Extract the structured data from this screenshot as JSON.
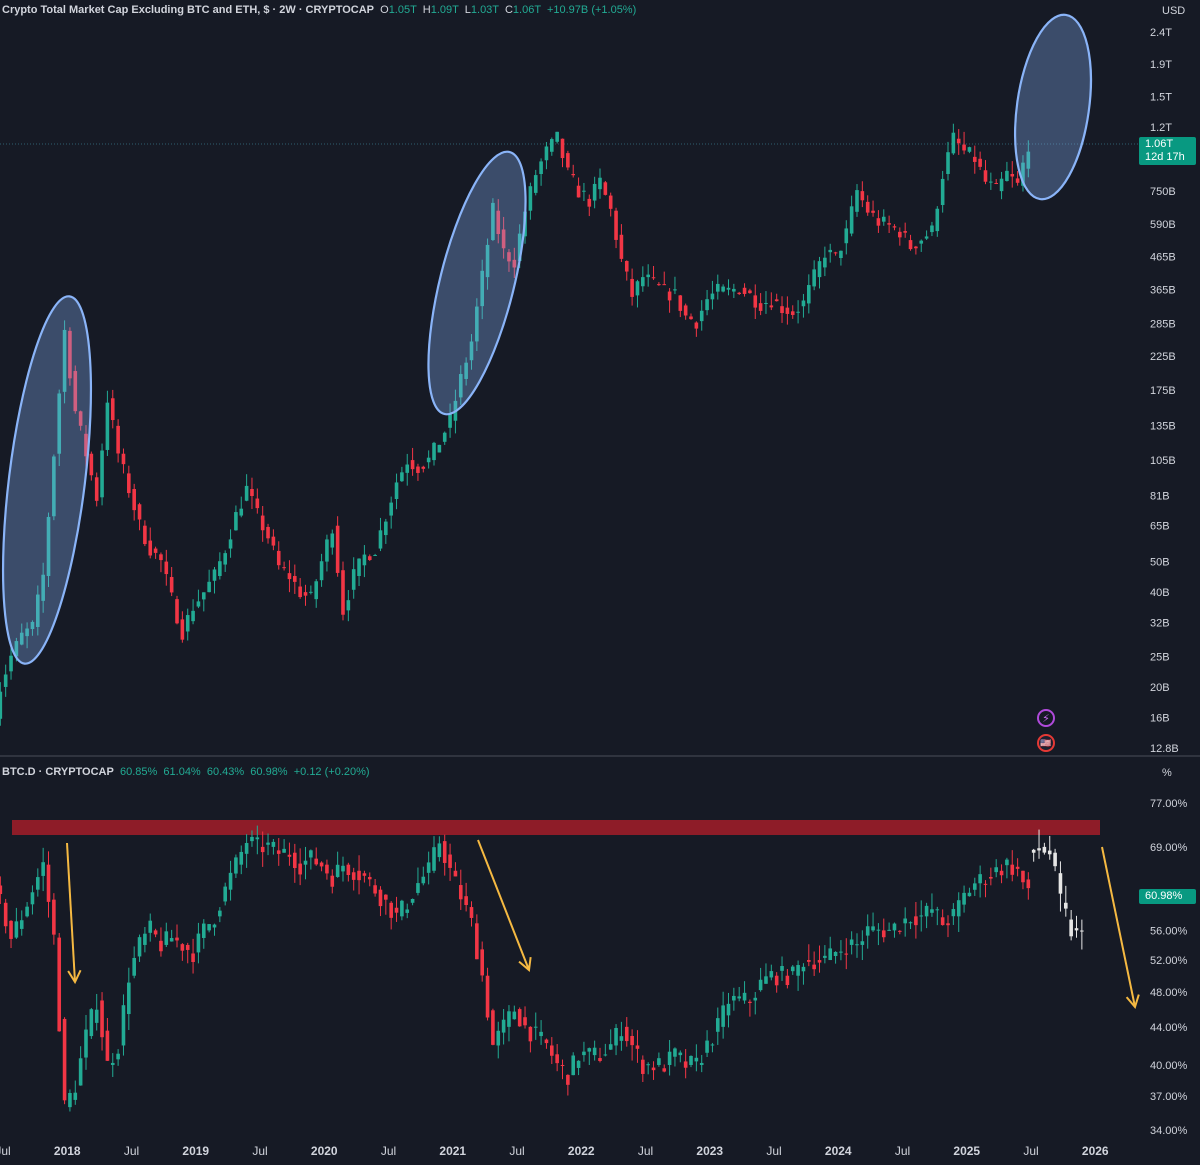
{
  "main_legend": {
    "symbol": "Crypto Total Market Cap Excluding BTC and ETH, $ · 2W · CRYPTOCAP",
    "o_label": "O",
    "o": "1.05T",
    "h_label": "H",
    "h": "1.09T",
    "l_label": "L",
    "l": "1.03T",
    "c_label": "C",
    "c": "1.06T",
    "change": "+10.97B (+1.05%)"
  },
  "main_unit": "USD",
  "main_price_tag": {
    "price": "1.06T",
    "countdown": "12d 17h"
  },
  "dom_legend": {
    "symbol": "BTC.D · CRYPTOCAP",
    "o": "60.85%",
    "h": "61.04%",
    "l": "60.43%",
    "c": "60.98%",
    "change": "+0.12 (+0.20%)"
  },
  "dom_unit": "%",
  "dom_price_tag": "60.98%",
  "icons": {
    "lightning": "lightning-icon",
    "flag": "us-flag-icon"
  },
  "colors": {
    "background": "#161a25",
    "up": "#22ab94",
    "down": "#f23645",
    "ellipse": "#8ab4f8",
    "arrow": "#f5b942",
    "resistance": "#8e1c28",
    "projection": "#e6e6e6",
    "text": "#d1d4dc",
    "grid": "#2a2e39"
  },
  "chart_data": [
    {
      "type": "candlestick",
      "title": "Crypto Total Market Cap Excluding BTC and ETH, $ · 2W · CRYPTOCAP",
      "y_scale": "log",
      "y_unit": "USD",
      "y_ticks": [
        "2.4T",
        "1.9T",
        "1.5T",
        "1.2T",
        "750B",
        "590B",
        "465B",
        "365B",
        "285B",
        "225B",
        "175B",
        "135B",
        "105B",
        "81B",
        "65B",
        "50B",
        "40B",
        "32B",
        "25B",
        "20B",
        "16B",
        "12.8B"
      ],
      "current_price": "1.06T",
      "bar_countdown": "12d 17h",
      "x_tick_labels": [
        "Jul",
        "2018",
        "Jul",
        "2019",
        "Jul",
        "2020",
        "Jul",
        "2021",
        "Jul",
        "2022",
        "Jul",
        "2023",
        "Jul",
        "2024",
        "Jul",
        "2025",
        "Jul",
        "2026"
      ],
      "series_close_USD": [
        {
          "date": "2017-06",
          "close": 13000000000.0
        },
        {
          "date": "2017-07",
          "close": 20000000000.0
        },
        {
          "date": "2017-08",
          "close": 25000000000.0
        },
        {
          "date": "2017-09",
          "close": 29000000000.0
        },
        {
          "date": "2017-10",
          "close": 31000000000.0
        },
        {
          "date": "2017-11",
          "close": 45000000000.0
        },
        {
          "date": "2017-12",
          "close": 110000000000.0
        },
        {
          "date": "2018-01",
          "close": 270000000000.0
        },
        {
          "date": "2018-02",
          "close": 150000000000.0
        },
        {
          "date": "2018-03",
          "close": 110000000000.0
        },
        {
          "date": "2018-04",
          "close": 80000000000.0
        },
        {
          "date": "2018-05",
          "close": 165000000000.0
        },
        {
          "date": "2018-06",
          "close": 110000000000.0
        },
        {
          "date": "2018-07",
          "close": 85000000000.0
        },
        {
          "date": "2018-08",
          "close": 65000000000.0
        },
        {
          "date": "2018-09",
          "close": 55000000000.0
        },
        {
          "date": "2018-10",
          "close": 50000000000.0
        },
        {
          "date": "2018-11",
          "close": 38000000000.0
        },
        {
          "date": "2018-12",
          "close": 30000000000.0
        },
        {
          "date": "2019-01",
          "close": 36000000000.0
        },
        {
          "date": "2019-02",
          "close": 40000000000.0
        },
        {
          "date": "2019-03",
          "close": 45000000000.0
        },
        {
          "date": "2019-04",
          "close": 55000000000.0
        },
        {
          "date": "2019-05",
          "close": 70000000000.0
        },
        {
          "date": "2019-06",
          "close": 85000000000.0
        },
        {
          "date": "2019-07",
          "close": 70000000000.0
        },
        {
          "date": "2019-08",
          "close": 60000000000.0
        },
        {
          "date": "2019-09",
          "close": 48000000000.0
        },
        {
          "date": "2019-10",
          "close": 45000000000.0
        },
        {
          "date": "2019-11",
          "close": 40000000000.0
        },
        {
          "date": "2019-12",
          "close": 38000000000.0
        },
        {
          "date": "2020-01",
          "close": 50000000000.0
        },
        {
          "date": "2020-02",
          "close": 65000000000.0
        },
        {
          "date": "2020-03",
          "close": 35000000000.0
        },
        {
          "date": "2020-04",
          "close": 45000000000.0
        },
        {
          "date": "2020-05",
          "close": 52000000000.0
        },
        {
          "date": "2020-06",
          "close": 55000000000.0
        },
        {
          "date": "2020-07",
          "close": 70000000000.0
        },
        {
          "date": "2020-08",
          "close": 90000000000.0
        },
        {
          "date": "2020-09",
          "close": 105000000000.0
        },
        {
          "date": "2020-10",
          "close": 100000000000.0
        },
        {
          "date": "2020-11",
          "close": 105000000000.0
        },
        {
          "date": "2020-12",
          "close": 120000000000.0
        },
        {
          "date": "2021-01",
          "close": 140000000000.0
        },
        {
          "date": "2021-02",
          "close": 190000000000.0
        },
        {
          "date": "2021-03",
          "close": 250000000000.0
        },
        {
          "date": "2021-04",
          "close": 400000000000.0
        },
        {
          "date": "2021-05",
          "close": 650000000000.0
        },
        {
          "date": "2021-06",
          "close": 480000000000.0
        },
        {
          "date": "2021-07",
          "close": 450000000000.0
        },
        {
          "date": "2021-08",
          "close": 650000000000.0
        },
        {
          "date": "2021-09",
          "close": 850000000000.0
        },
        {
          "date": "2021-10",
          "close": 1000000000000.0
        },
        {
          "date": "2021-11",
          "close": 1100000000000.0
        },
        {
          "date": "2021-12",
          "close": 850000000000.0
        },
        {
          "date": "2022-01",
          "close": 750000000000.0
        },
        {
          "date": "2022-02",
          "close": 700000000000.0
        },
        {
          "date": "2022-03",
          "close": 800000000000.0
        },
        {
          "date": "2022-04",
          "close": 650000000000.0
        },
        {
          "date": "2022-05",
          "close": 450000000000.0
        },
        {
          "date": "2022-06",
          "close": 350000000000.0
        },
        {
          "date": "2022-07",
          "close": 400000000000.0
        },
        {
          "date": "2022-08",
          "close": 380000000000.0
        },
        {
          "date": "2022-09",
          "close": 360000000000.0
        },
        {
          "date": "2022-10",
          "close": 350000000000.0
        },
        {
          "date": "2022-11",
          "close": 300000000000.0
        },
        {
          "date": "2022-12",
          "close": 290000000000.0
        },
        {
          "date": "2023-01",
          "close": 340000000000.0
        },
        {
          "date": "2023-02",
          "close": 360000000000.0
        },
        {
          "date": "2023-03",
          "close": 360000000000.0
        },
        {
          "date": "2023-04",
          "close": 370000000000.0
        },
        {
          "date": "2023-05",
          "close": 350000000000.0
        },
        {
          "date": "2023-06",
          "close": 330000000000.0
        },
        {
          "date": "2023-07",
          "close": 340000000000.0
        },
        {
          "date": "2023-08",
          "close": 320000000000.0
        },
        {
          "date": "2023-09",
          "close": 310000000000.0
        },
        {
          "date": "2023-10",
          "close": 330000000000.0
        },
        {
          "date": "2023-11",
          "close": 400000000000.0
        },
        {
          "date": "2023-12",
          "close": 480000000000.0
        },
        {
          "date": "2024-01",
          "close": 460000000000.0
        },
        {
          "date": "2024-02",
          "close": 550000000000.0
        },
        {
          "date": "2024-03",
          "close": 750000000000.0
        },
        {
          "date": "2024-04",
          "close": 650000000000.0
        },
        {
          "date": "2024-05",
          "close": 600000000000.0
        },
        {
          "date": "2024-06",
          "close": 580000000000.0
        },
        {
          "date": "2024-07",
          "close": 560000000000.0
        },
        {
          "date": "2024-08",
          "close": 500000000000.0
        },
        {
          "date": "2024-09",
          "close": 530000000000.0
        },
        {
          "date": "2024-10",
          "close": 560000000000.0
        },
        {
          "date": "2024-11",
          "close": 850000000000.0
        },
        {
          "date": "2024-12",
          "close": 1100000000000.0
        },
        {
          "date": "2025-01",
          "close": 1000000000000.0
        },
        {
          "date": "2025-02",
          "close": 950000000000.0
        },
        {
          "date": "2025-03",
          "close": 800000000000.0
        },
        {
          "date": "2025-04",
          "close": 750000000000.0
        },
        {
          "date": "2025-05",
          "close": 850000000000.0
        },
        {
          "date": "2025-06",
          "close": 780000000000.0
        },
        {
          "date": "2025-07",
          "close": 1060000000000.0
        }
      ],
      "annotations": [
        {
          "type": "ellipse",
          "label": "",
          "from": "2017-06",
          "to": "2018-01"
        },
        {
          "type": "ellipse",
          "label": "",
          "from": "2020-12",
          "to": "2021-05"
        },
        {
          "type": "ellipse",
          "label": "",
          "from": "2025-05",
          "to": "2025-07"
        }
      ]
    },
    {
      "type": "candlestick",
      "title": "BTC.D · CRYPTOCAP",
      "y_scale": "log",
      "y_unit": "%",
      "y_ticks": [
        "77.00%",
        "69.00%",
        "60.98%",
        "56.00%",
        "52.00%",
        "48.00%",
        "44.00%",
        "40.00%",
        "37.00%",
        "34.00%"
      ],
      "current_value": "60.98%",
      "series_close_pct": [
        {
          "date": "2017-06",
          "close": 64
        },
        {
          "date": "2017-07",
          "close": 60
        },
        {
          "date": "2017-08",
          "close": 55
        },
        {
          "date": "2017-09",
          "close": 58
        },
        {
          "date": "2017-10",
          "close": 62
        },
        {
          "date": "2017-11",
          "close": 66
        },
        {
          "date": "2017-12",
          "close": 55
        },
        {
          "date": "2018-01",
          "close": 36
        },
        {
          "date": "2018-02",
          "close": 38
        },
        {
          "date": "2018-03",
          "close": 43
        },
        {
          "date": "2018-04",
          "close": 47
        },
        {
          "date": "2018-05",
          "close": 40
        },
        {
          "date": "2018-06",
          "close": 42
        },
        {
          "date": "2018-07",
          "close": 50
        },
        {
          "date": "2018-08",
          "close": 54
        },
        {
          "date": "2018-09",
          "close": 56
        },
        {
          "date": "2018-10",
          "close": 54
        },
        {
          "date": "2018-11",
          "close": 55
        },
        {
          "date": "2018-12",
          "close": 54
        },
        {
          "date": "2019-01",
          "close": 53
        },
        {
          "date": "2019-02",
          "close": 56
        },
        {
          "date": "2019-03",
          "close": 58
        },
        {
          "date": "2019-04",
          "close": 62
        },
        {
          "date": "2019-05",
          "close": 66
        },
        {
          "date": "2019-06",
          "close": 70
        },
        {
          "date": "2019-07",
          "close": 69
        },
        {
          "date": "2019-08",
          "close": 69
        },
        {
          "date": "2019-09",
          "close": 68
        },
        {
          "date": "2019-10",
          "close": 68
        },
        {
          "date": "2019-11",
          "close": 66
        },
        {
          "date": "2019-12",
          "close": 67
        },
        {
          "date": "2020-01",
          "close": 66
        },
        {
          "date": "2020-02",
          "close": 64
        },
        {
          "date": "2020-03",
          "close": 66
        },
        {
          "date": "2020-04",
          "close": 65
        },
        {
          "date": "2020-05",
          "close": 64
        },
        {
          "date": "2020-06",
          "close": 62
        },
        {
          "date": "2020-07",
          "close": 60
        },
        {
          "date": "2020-08",
          "close": 58
        },
        {
          "date": "2020-09",
          "close": 60
        },
        {
          "date": "2020-10",
          "close": 63
        },
        {
          "date": "2020-11",
          "close": 65
        },
        {
          "date": "2020-12",
          "close": 70
        },
        {
          "date": "2021-01",
          "close": 65
        },
        {
          "date": "2021-02",
          "close": 61
        },
        {
          "date": "2021-03",
          "close": 57
        },
        {
          "date": "2021-04",
          "close": 50
        },
        {
          "date": "2021-05",
          "close": 42
        },
        {
          "date": "2021-06",
          "close": 44
        },
        {
          "date": "2021-07",
          "close": 46
        },
        {
          "date": "2021-08",
          "close": 44
        },
        {
          "date": "2021-09",
          "close": 43
        },
        {
          "date": "2021-10",
          "close": 42
        },
        {
          "date": "2021-11",
          "close": 40
        },
        {
          "date": "2021-12",
          "close": 39
        },
        {
          "date": "2022-01",
          "close": 41
        },
        {
          "date": "2022-02",
          "close": 41
        },
        {
          "date": "2022-03",
          "close": 41
        },
        {
          "date": "2022-04",
          "close": 42
        },
        {
          "date": "2022-05",
          "close": 44
        },
        {
          "date": "2022-06",
          "close": 42
        },
        {
          "date": "2022-07",
          "close": 40
        },
        {
          "date": "2022-08",
          "close": 40
        },
        {
          "date": "2022-09",
          "close": 40
        },
        {
          "date": "2022-10",
          "close": 41
        },
        {
          "date": "2022-11",
          "close": 40
        },
        {
          "date": "2022-12",
          "close": 40
        },
        {
          "date": "2023-01",
          "close": 42
        },
        {
          "date": "2023-02",
          "close": 44
        },
        {
          "date": "2023-03",
          "close": 47
        },
        {
          "date": "2023-04",
          "close": 47
        },
        {
          "date": "2023-05",
          "close": 47
        },
        {
          "date": "2023-06",
          "close": 49
        },
        {
          "date": "2023-07",
          "close": 50
        },
        {
          "date": "2023-08",
          "close": 50
        },
        {
          "date": "2023-09",
          "close": 50
        },
        {
          "date": "2023-10",
          "close": 52
        },
        {
          "date": "2023-11",
          "close": 52
        },
        {
          "date": "2023-12",
          "close": 52
        },
        {
          "date": "2024-01",
          "close": 53
        },
        {
          "date": "2024-02",
          "close": 54
        },
        {
          "date": "2024-03",
          "close": 54
        },
        {
          "date": "2024-04",
          "close": 56
        },
        {
          "date": "2024-05",
          "close": 56
        },
        {
          "date": "2024-06",
          "close": 56
        },
        {
          "date": "2024-07",
          "close": 57
        },
        {
          "date": "2024-08",
          "close": 58
        },
        {
          "date": "2024-09",
          "close": 58
        },
        {
          "date": "2024-10",
          "close": 59
        },
        {
          "date": "2024-11",
          "close": 57
        },
        {
          "date": "2024-12",
          "close": 58
        },
        {
          "date": "2025-01",
          "close": 61
        },
        {
          "date": "2025-02",
          "close": 63
        },
        {
          "date": "2025-03",
          "close": 64
        },
        {
          "date": "2025-04",
          "close": 65
        },
        {
          "date": "2025-05",
          "close": 66
        },
        {
          "date": "2025-06",
          "close": 65
        },
        {
          "date": "2025-07",
          "close": 60.98
        }
      ],
      "projection_close_pct": [
        {
          "date": "2025-07",
          "close": 68
        },
        {
          "date": "2025-08",
          "close": 69
        },
        {
          "date": "2025-09",
          "close": 68
        },
        {
          "date": "2025-10",
          "close": 60
        },
        {
          "date": "2025-11",
          "close": 56
        },
        {
          "date": "2025-12",
          "close": 55
        }
      ],
      "annotations": [
        {
          "type": "rectangle",
          "label": "",
          "y_pct": 73
        },
        {
          "type": "arrow",
          "label": "",
          "from": "2017-12",
          "to": "2018-02"
        },
        {
          "type": "arrow",
          "label": "",
          "from": "2021-01",
          "to": "2021-06"
        },
        {
          "type": "arrow",
          "label": "",
          "from": "2025-10",
          "to": "2026-01"
        }
      ]
    }
  ]
}
